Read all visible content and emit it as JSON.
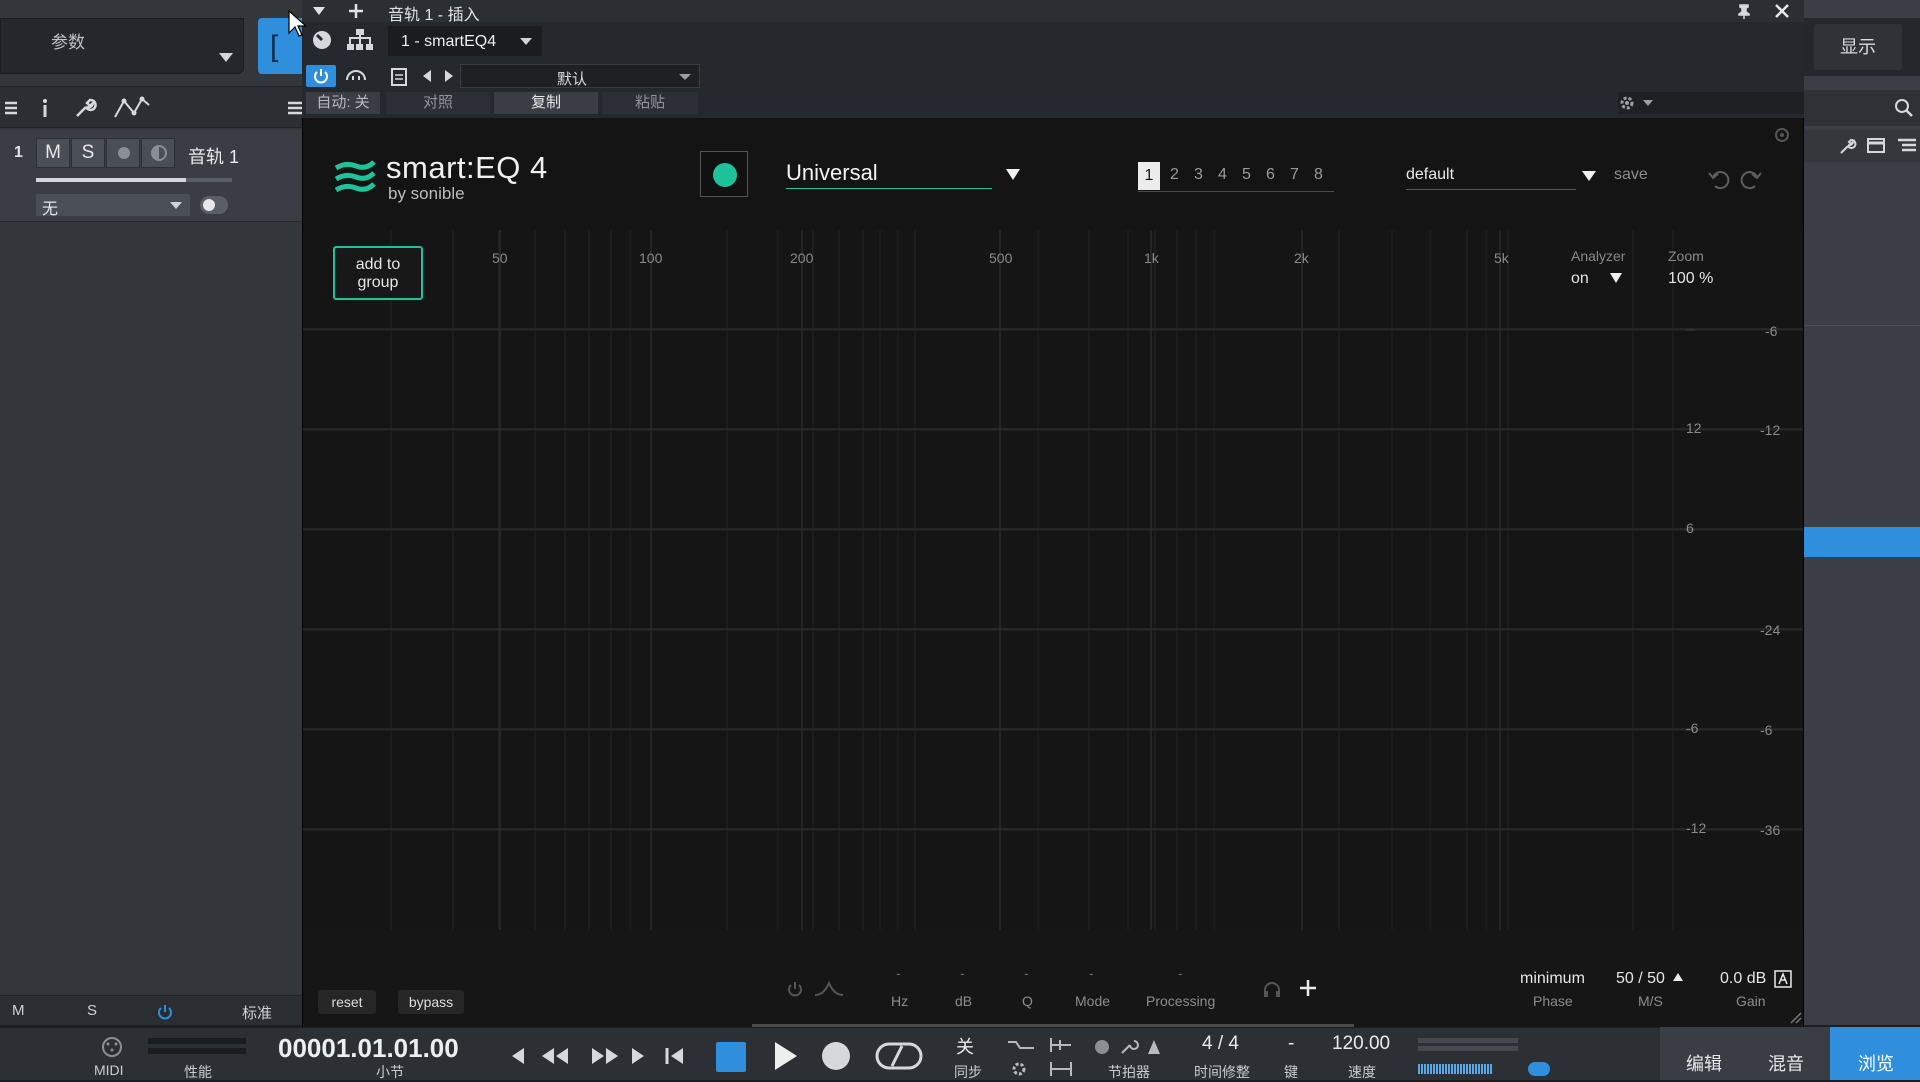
{
  "host": {
    "param_label": "参数",
    "display_label": "显示",
    "track": {
      "number": "1",
      "mute": "M",
      "solo": "S",
      "name": "音轨 1",
      "input": "无"
    },
    "footer": {
      "m": "M",
      "s": "S",
      "mode": "标准"
    }
  },
  "plugin_window": {
    "title": "音轨 1 - 插入",
    "plugin_select": "1 - smartEQ4",
    "preset": "默认",
    "auto_label": "自动: 关",
    "compare_label": "对照",
    "copy_label": "复制",
    "paste_label": "粘贴"
  },
  "smarteq": {
    "logo": "smart:EQ 4",
    "logo_sub": "by sonible",
    "profile": "Universal",
    "groups": [
      "1",
      "2",
      "3",
      "4",
      "5",
      "6",
      "7",
      "8"
    ],
    "selected_group": "1",
    "preset_name": "default",
    "save_label": "save",
    "add_to_group_line1": "add to",
    "add_to_group_line2": "group",
    "analyzer_label": "Analyzer",
    "analyzer_value": "on",
    "zoom_label": "Zoom",
    "zoom_value": "100 %",
    "freq_ticks": [
      "50",
      "100",
      "200",
      "500",
      "1k",
      "2k",
      "5k"
    ],
    "gain_ticks": [
      "12",
      "6",
      "-6",
      "-12"
    ],
    "db_ticks": [
      "-6",
      "-12",
      "-24",
      "-6",
      "-36"
    ],
    "bottom": {
      "reset": "reset",
      "bypass": "bypass",
      "hz_label": "Hz",
      "db_label": "dB",
      "q_label": "Q",
      "mode_label": "Mode",
      "processing_label": "Processing",
      "dash": "-",
      "phase_value": "minimum",
      "phase_label": "Phase",
      "ms_value": "50 / 50",
      "ms_label": "M/S",
      "gain_value": "0.0 dB",
      "gain_label": "Gain"
    }
  },
  "transport": {
    "midi": "MIDI",
    "perf": "性能",
    "time": "00001.01.01.00",
    "unit": "小节",
    "sync_value": "关",
    "sync": "同步",
    "metronome": "节拍器",
    "signature": "4 / 4",
    "time_fix": "时间修整",
    "key_value": "-",
    "key": "键",
    "tempo": "120.00",
    "tempo_label": "速度",
    "edit": "编辑",
    "mix": "混音",
    "browse": "浏览"
  },
  "colors": {
    "accent": "#2f8fdc",
    "eq_green": "#1fc39b"
  }
}
